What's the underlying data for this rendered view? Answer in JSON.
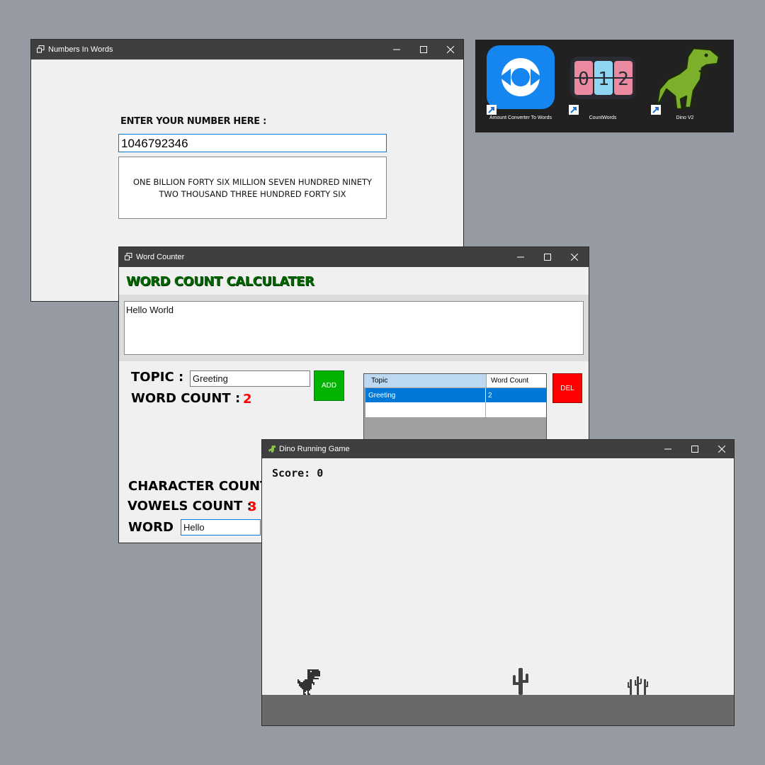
{
  "numbers_window": {
    "title": "Numbers In Words",
    "prompt_label": "ENTER YOUR NUMBER HERE :",
    "input_value": "1046792346",
    "result_line1": "ONE BILLION FORTY SIX MILLION SEVEN HUNDRED NINETY",
    "result_line2": "TWO THOUSAND THREE HUNDRED FORTY SIX"
  },
  "desktop": {
    "icons": [
      {
        "label": "Amount Converter To Words",
        "icon": "refresh-icon",
        "color": "#1585f0"
      },
      {
        "label": "CountWords",
        "icon": "counter-icon",
        "color": "#2b2b33"
      },
      {
        "label": "Dino V2",
        "icon": "dinosaur-icon",
        "color": "#7db02a"
      }
    ]
  },
  "word_counter": {
    "title": "Word Counter",
    "heading": "WORD COUNT CALCULATER",
    "text_content": "Hello World",
    "topic_label": "TOPIC :",
    "topic_value": "Greeting",
    "add_label": "ADD",
    "word_count_label": "WORD COUNT :",
    "word_count_value": "2",
    "table": {
      "headers": [
        "Topic",
        "Word Count"
      ],
      "rows": [
        [
          "Greeting",
          "2"
        ]
      ]
    },
    "del_label": "DEL",
    "char_count_label": "CHARACTER COUNT",
    "vowels_label": "VOWELS COUNT :",
    "vowels_value": "3",
    "word_label": "WORD",
    "word_value": "Hello",
    "colors": {
      "heading": "#006400",
      "count": "#ff0000",
      "add": "#00b400",
      "del": "#ff0000",
      "selected_row": "#0078d7"
    }
  },
  "dino_game": {
    "title": "Dino Running Game",
    "score_label": "Score: 0"
  }
}
